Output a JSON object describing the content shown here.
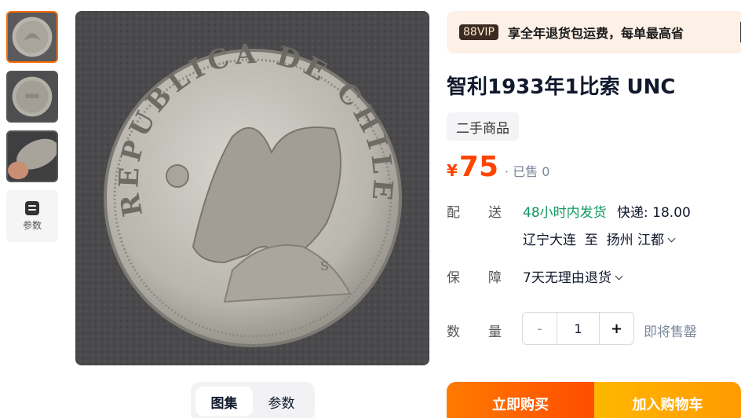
{
  "thumbnails": [
    {
      "name": "coin-thumb-1",
      "active": true
    },
    {
      "name": "coin-thumb-2",
      "active": false
    },
    {
      "name": "coin-thumb-3",
      "active": false
    }
  ],
  "param_thumb": {
    "label": "参数",
    "icon": "params-icon"
  },
  "main_image": {
    "subject": "coin-photo",
    "coin_text": "REPUBLICA DE CHILE",
    "mint_mark": "S"
  },
  "tabs": [
    {
      "label": "图集",
      "active": true
    },
    {
      "label": "参数",
      "active": false
    }
  ],
  "vip": {
    "badge": "88VIP",
    "text": "享全年退货包运费，每单最高省"
  },
  "product": {
    "title": "智利1933年1比索 UNC",
    "tag": "二手商品"
  },
  "price": {
    "currency": "¥",
    "value": "75",
    "sold": "· 已售 0"
  },
  "delivery": {
    "label": "配送",
    "time": "48小时内发货",
    "fee": "快递: 18.00",
    "route": "辽宁大连  至  扬州 江都"
  },
  "guarantee": {
    "label": "保障",
    "text": "7天无理由退货"
  },
  "quantity": {
    "label": "数量",
    "minus": "-",
    "value": "1",
    "plus": "+",
    "status": "即将售罄"
  },
  "actions": {
    "buy": "立即购买",
    "cart": "加入购物车"
  },
  "colors": {
    "accent": "#ff4400",
    "green": "#0f9960",
    "buy": "#ff5a00",
    "cart": "#ffaa00"
  }
}
